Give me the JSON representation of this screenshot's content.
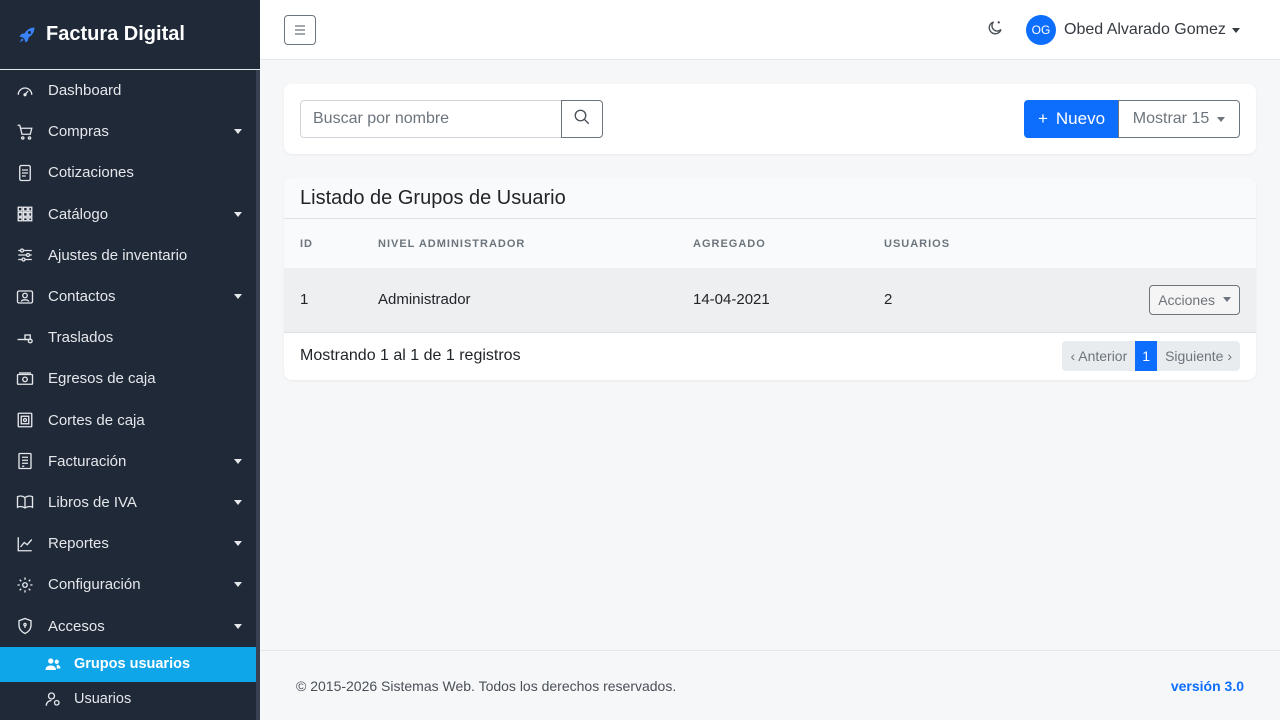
{
  "brand": {
    "name": "Factura Digital",
    "logo_icon": "rocket-icon"
  },
  "sidebar": {
    "items": [
      {
        "label": "Dashboard",
        "icon": "gauge-icon",
        "has_submenu": false
      },
      {
        "label": "Compras",
        "icon": "cart-icon",
        "has_submenu": true
      },
      {
        "label": "Cotizaciones",
        "icon": "document-icon",
        "has_submenu": false
      },
      {
        "label": "Catálogo",
        "icon": "grid-icon",
        "has_submenu": true
      },
      {
        "label": "Ajustes de inventario",
        "icon": "sliders-icon",
        "has_submenu": false
      },
      {
        "label": "Contactos",
        "icon": "contact-card-icon",
        "has_submenu": true
      },
      {
        "label": "Traslados",
        "icon": "dolly-icon",
        "has_submenu": false
      },
      {
        "label": "Egresos de caja",
        "icon": "cash-icon",
        "has_submenu": false
      },
      {
        "label": "Cortes de caja",
        "icon": "safe-icon",
        "has_submenu": false
      },
      {
        "label": "Facturación",
        "icon": "invoice-icon",
        "has_submenu": true
      },
      {
        "label": "Libros de IVA",
        "icon": "book-icon",
        "has_submenu": true
      },
      {
        "label": "Reportes",
        "icon": "chart-line-icon",
        "has_submenu": true
      },
      {
        "label": "Configuración",
        "icon": "gear-icon",
        "has_submenu": true
      },
      {
        "label": "Accesos",
        "icon": "shield-icon",
        "has_submenu": true
      }
    ],
    "subitems": [
      {
        "label": "Grupos usuarios",
        "icon": "users-icon",
        "active": true
      },
      {
        "label": "Usuarios",
        "icon": "user-gear-icon",
        "active": false
      }
    ],
    "active_color": "#0ea5e9",
    "background": "#1f2937"
  },
  "header": {
    "toggle_icon": "hamburger-icon",
    "theme_icon": "moon-icon",
    "user": {
      "initials": "OG",
      "name": "Obed Alvarado Gomez"
    }
  },
  "toolbar": {
    "search_placeholder": "Buscar por nombre",
    "search_value": "",
    "new_label": "Nuevo",
    "show_label": "Mostrar 15"
  },
  "list": {
    "title": "Listado de Grupos de Usuario",
    "columns": [
      "ID",
      "NIVEL ADMINISTRADOR",
      "AGREGADO",
      "USUARIOS",
      ""
    ],
    "rows": [
      {
        "id": "1",
        "nivel": "Administrador",
        "agregado": "14-04-2021",
        "usuarios": "2",
        "action": "Acciones"
      }
    ],
    "summary": "Mostrando 1 al 1 de 1 registros",
    "pagination": {
      "prev": "‹ Anterior",
      "current": "1",
      "next": "Siguiente ›"
    }
  },
  "footer": {
    "copyright": "© 2015-2026 Sistemas Web. Todos los derechos reservados.",
    "version": "versión 3.0"
  },
  "colors": {
    "primary": "#0d6efd",
    "sidebar_bg": "#1f2937"
  }
}
